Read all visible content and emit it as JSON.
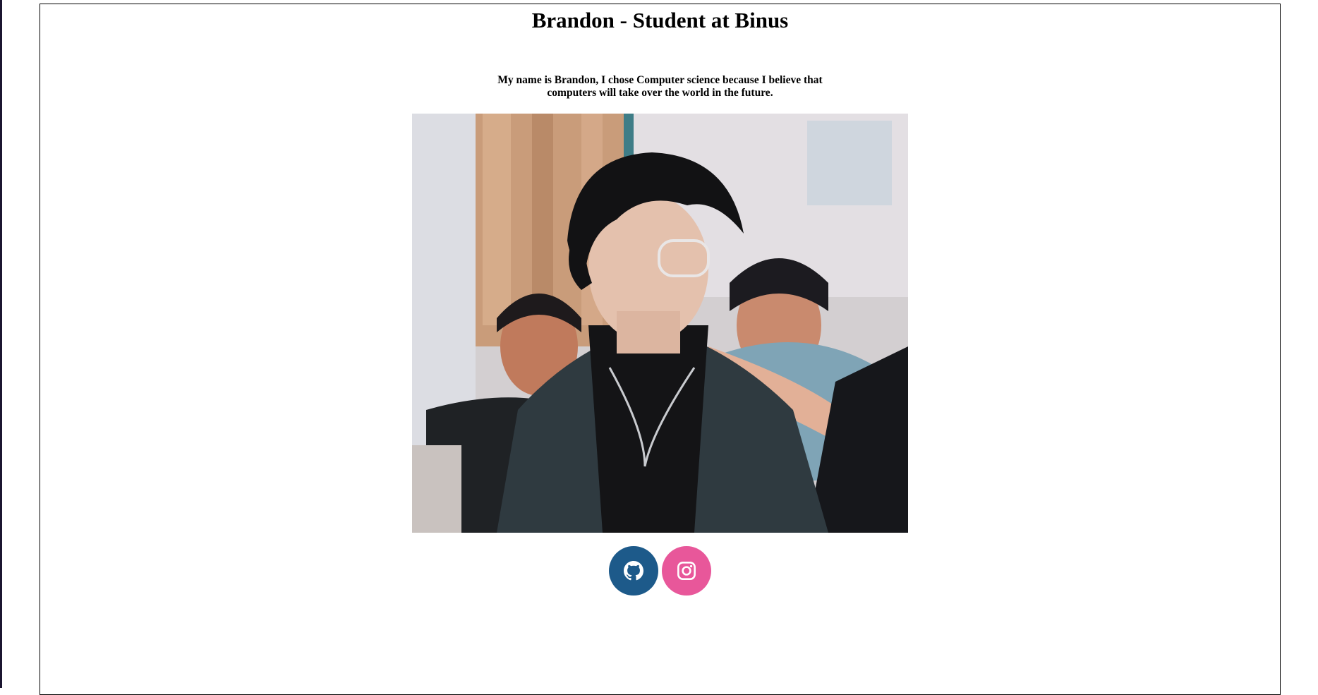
{
  "page": {
    "title": "Brandon - Student at Binus",
    "intro_line_1": "My name is Brandon, I chose Computer science because I believe that",
    "intro_line_2": "computers will take over the world in the future."
  },
  "photo": {
    "alt": "Photo of Brandon"
  },
  "socials": [
    {
      "name": "GitHub",
      "icon": "github-icon",
      "color": "#1d5a8a"
    },
    {
      "name": "Instagram",
      "icon": "instagram-icon",
      "color": "#e8579a"
    }
  ]
}
